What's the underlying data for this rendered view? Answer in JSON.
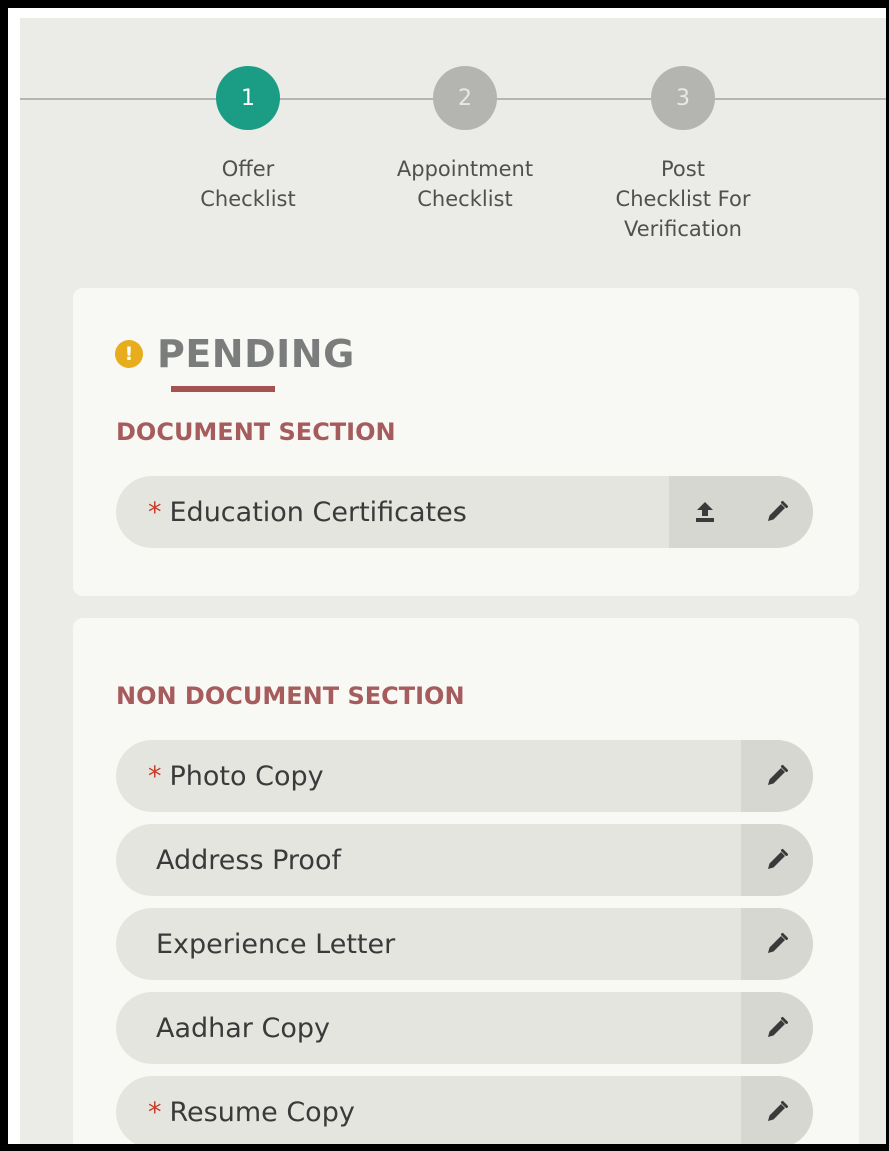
{
  "stepper": {
    "steps": [
      {
        "number": "1",
        "label": "Offer\nChecklist",
        "active": true
      },
      {
        "number": "2",
        "label": "Appointment\nChecklist",
        "active": false
      },
      {
        "number": "3",
        "label": "Post\nChecklist For\nVerification",
        "active": false
      }
    ]
  },
  "status": {
    "title": "PENDING",
    "icon": "warning-icon",
    "color": "#e8ad1d"
  },
  "document_section": {
    "title": "DOCUMENT SECTION",
    "items": [
      {
        "label": "Education Certificates",
        "required": "*",
        "actions": [
          "upload-icon",
          "edit-icon"
        ]
      }
    ]
  },
  "non_document_section": {
    "title": "NON DOCUMENT SECTION",
    "items": [
      {
        "label": "Photo Copy",
        "required": "*",
        "actions": [
          "edit-icon"
        ]
      },
      {
        "label": "Address Proof",
        "required": "",
        "actions": [
          "edit-icon"
        ]
      },
      {
        "label": "Experience Letter",
        "required": "",
        "actions": [
          "edit-icon"
        ]
      },
      {
        "label": "Aadhar Copy",
        "required": "",
        "actions": [
          "edit-icon"
        ]
      },
      {
        "label": "Resume Copy",
        "required": "*",
        "actions": [
          "edit-icon"
        ]
      }
    ]
  },
  "colors": {
    "active_step": "#1a9c85",
    "inactive_step": "#b4b4b0",
    "section_title": "#a65c5c",
    "required_marker": "#c83b2a"
  }
}
